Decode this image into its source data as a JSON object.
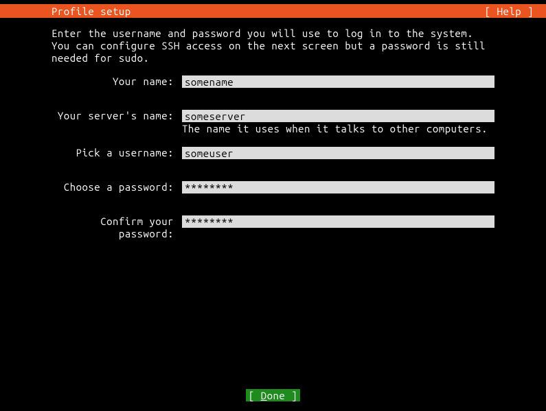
{
  "header": {
    "title": "Profile setup",
    "help": "[ Help ]"
  },
  "instructions": "Enter the username and password you will use to log in to the system. You can configure SSH access on the next screen but a password is still needed for sudo.",
  "form": {
    "name": {
      "label": "Your name:",
      "value": "somename"
    },
    "server": {
      "label": "Your server's name:",
      "value": "someserver",
      "helper": "The name it uses when it talks to other computers."
    },
    "username": {
      "label": "Pick a username:",
      "value": "someuser"
    },
    "password": {
      "label": "Choose a password:",
      "value": "********"
    },
    "confirm": {
      "label": "Confirm your password:",
      "value": "********"
    }
  },
  "footer": {
    "done_prefix": "[ ",
    "done_key": "D",
    "done_rest": "one",
    "done_suffix": "   ]"
  }
}
